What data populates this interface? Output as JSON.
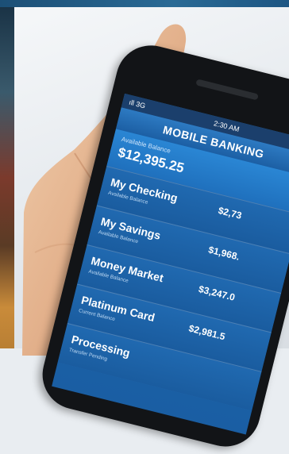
{
  "status_bar": {
    "signal": "ıll 3G",
    "time": "2:30 AM"
  },
  "app": {
    "title": "MOBILE BANKING"
  },
  "balance": {
    "label": "Available Balance",
    "amount": "$12,395.25"
  },
  "accounts": [
    {
      "name": "My Checking",
      "sub": "Available Balance",
      "amount": "$2,73"
    },
    {
      "name": "My Savings",
      "sub": "Available Balance",
      "amount": "$1,968."
    },
    {
      "name": "Money Market",
      "sub": "Available Balance",
      "amount": "$3,247.0"
    },
    {
      "name": "Platinum Card",
      "sub": "Current Balance",
      "amount": "$2,981.5"
    },
    {
      "name": "Processing",
      "sub": "Transfer Pending",
      "amount": ""
    }
  ],
  "colors": {
    "screen_blue": "#1f6db5",
    "header_blue": "#1b3f6c",
    "phone_body": "#121417"
  }
}
